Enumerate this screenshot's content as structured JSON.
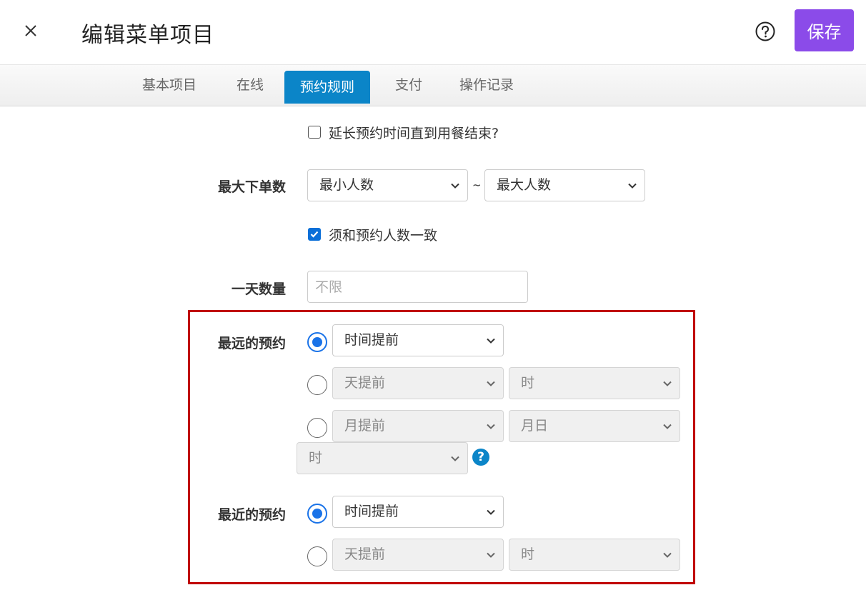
{
  "header": {
    "title": "编辑菜单项目",
    "save_label": "保存"
  },
  "tabs": [
    {
      "label": "基本项目"
    },
    {
      "label": "在线"
    },
    {
      "label": "预约规则"
    },
    {
      "label": "支付"
    },
    {
      "label": "操作记录"
    }
  ],
  "active_tab": "预约规则",
  "form": {
    "extend_checkbox": {
      "label": "延长预约时间直到用餐结束?",
      "checked": false
    },
    "max_orders": {
      "label": "最大下单数",
      "min_select": "最小人数",
      "separator": "~",
      "max_select": "最大人数"
    },
    "match_checkbox": {
      "label": "须和预约人数一致",
      "checked": true
    },
    "daily_quantity": {
      "label": "一天数量",
      "placeholder": "不限"
    },
    "farthest": {
      "label": "最远的预约",
      "option1_select": "时间提前",
      "option2_select_a": "天提前",
      "option2_select_b": "时",
      "option3_select_a": "月提前",
      "option3_select_b": "月日",
      "option3_select_c": "时",
      "help": "?"
    },
    "nearest": {
      "label": "最近的预约",
      "option1_select": "时间提前",
      "option2_select_a": "天提前",
      "option2_select_b": "时"
    }
  },
  "colors": {
    "accent": "#8b4be9",
    "tab_active": "#0b85c8",
    "radio_on": "#1a73e8",
    "highlight_border": "#c00000"
  }
}
